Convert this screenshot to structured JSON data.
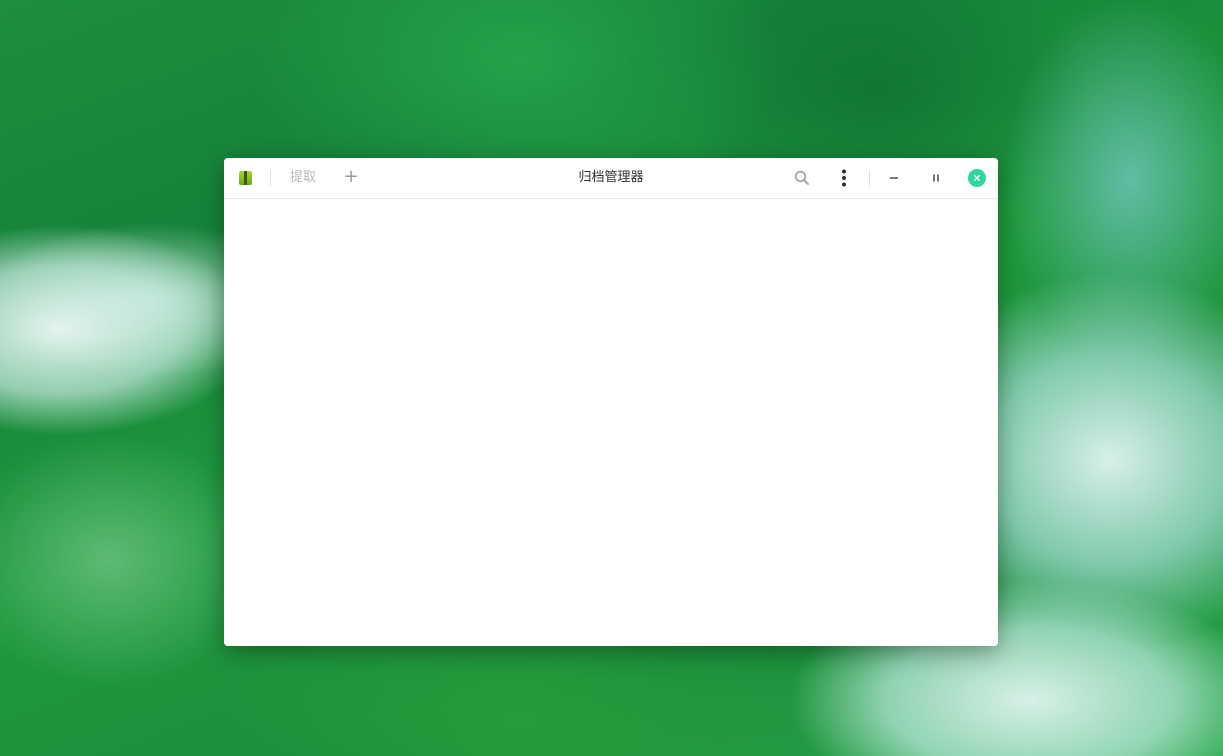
{
  "window": {
    "title": "归档管理器"
  },
  "toolbar": {
    "app_icon": "archive-manager-icon",
    "extract_label": "提取",
    "add_label": "+",
    "search_icon": "search-icon",
    "menu_icon": "more-vertical-icon"
  },
  "window_controls": {
    "minimize_icon": "minimize-icon",
    "maximize_icon": "maximize-icon",
    "close_icon": "close-icon"
  },
  "colors": {
    "close_button": "#2fd6a2",
    "app_icon_green": "#8cc02a",
    "desktop_green": "#1e8f3c"
  }
}
